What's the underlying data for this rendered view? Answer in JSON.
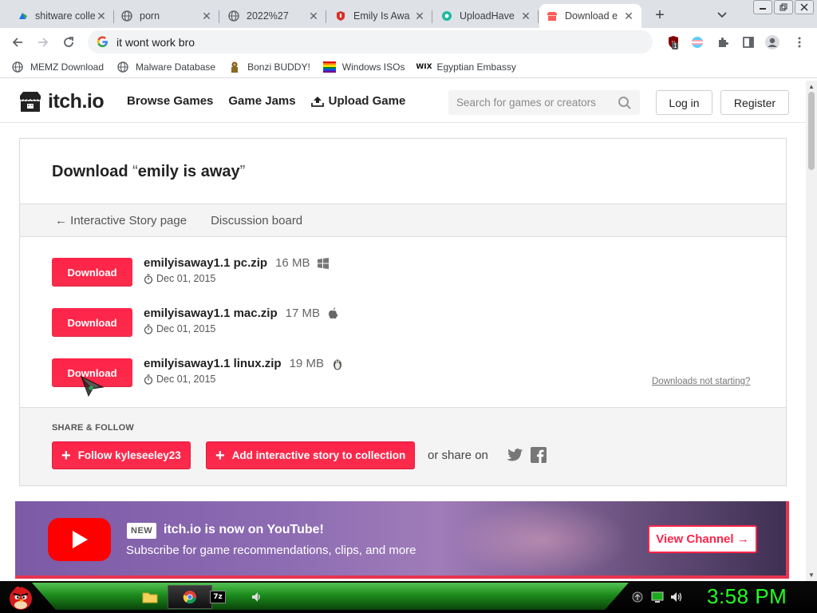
{
  "browser": {
    "tabs": [
      {
        "title": "shitware colle",
        "favicon": "cloud-icon",
        "active": false
      },
      {
        "title": "porn",
        "favicon": "globe-icon",
        "active": false
      },
      {
        "title": "2022%27",
        "favicon": "globe-icon",
        "active": false
      },
      {
        "title": "Emily Is Awa",
        "favicon": "red-shield-icon",
        "active": false
      },
      {
        "title": "UploadHave",
        "favicon": "teal-logo-icon",
        "active": false
      },
      {
        "title": "Download e",
        "favicon": "itchio-icon",
        "active": true
      }
    ],
    "address": "it wont work bro",
    "extension_badge": "1",
    "bookmarks": [
      {
        "label": "MEMZ Download",
        "icon": "globe-icon"
      },
      {
        "label": "Malware Database",
        "icon": "globe-icon"
      },
      {
        "label": "Bonzi BUDDY!",
        "icon": "bonzi-icon"
      },
      {
        "label": "Windows ISOs",
        "icon": "windows-flag-icon"
      },
      {
        "label": "Egyptian Embassy",
        "icon": "wix-icon"
      }
    ]
  },
  "itch": {
    "brand": "itch.io",
    "nav": [
      "Browse Games",
      "Game Jams",
      "Upload Game"
    ],
    "search_placeholder": "Search for games or creators",
    "login": "Log in",
    "register": "Register"
  },
  "download_page": {
    "title_prefix": "Download",
    "title_name": "emily is away",
    "subnav_back": "← Interactive Story page",
    "subnav_discussion": "Discussion board",
    "download_label": "Download",
    "files": [
      {
        "name": "emilyisaway1.1 pc.zip",
        "size": "16 MB",
        "platform": "windows-icon",
        "date": "Dec 01, 2015"
      },
      {
        "name": "emilyisaway1.1 mac.zip",
        "size": "17 MB",
        "platform": "apple-icon",
        "date": "Dec 01, 2015"
      },
      {
        "name": "emilyisaway1.1 linux.zip",
        "size": "19 MB",
        "platform": "linux-tux-icon",
        "date": "Dec 01, 2015"
      }
    ],
    "not_starting": "Downloads not starting?",
    "share_label": "SHARE & FOLLOW",
    "follow_label": "Follow kyleseeley23",
    "collection_label": "Add interactive story to collection",
    "or_share": "or share on"
  },
  "youtube_banner": {
    "badge": "NEW",
    "title": "itch.io is now on YouTube!",
    "subtitle": "Subscribe for game recommendations, clips, and more",
    "button": "View Channel →"
  },
  "taskbar": {
    "clock": "3:58 PM",
    "pinned": [
      "folder-icon",
      "chrome-icon",
      "7zip-icon",
      "winamp-icon"
    ]
  },
  "colors": {
    "itch_red": "#fa2c4c",
    "tab_bar": "#dee1e6",
    "clock_green": "#22ff22"
  }
}
